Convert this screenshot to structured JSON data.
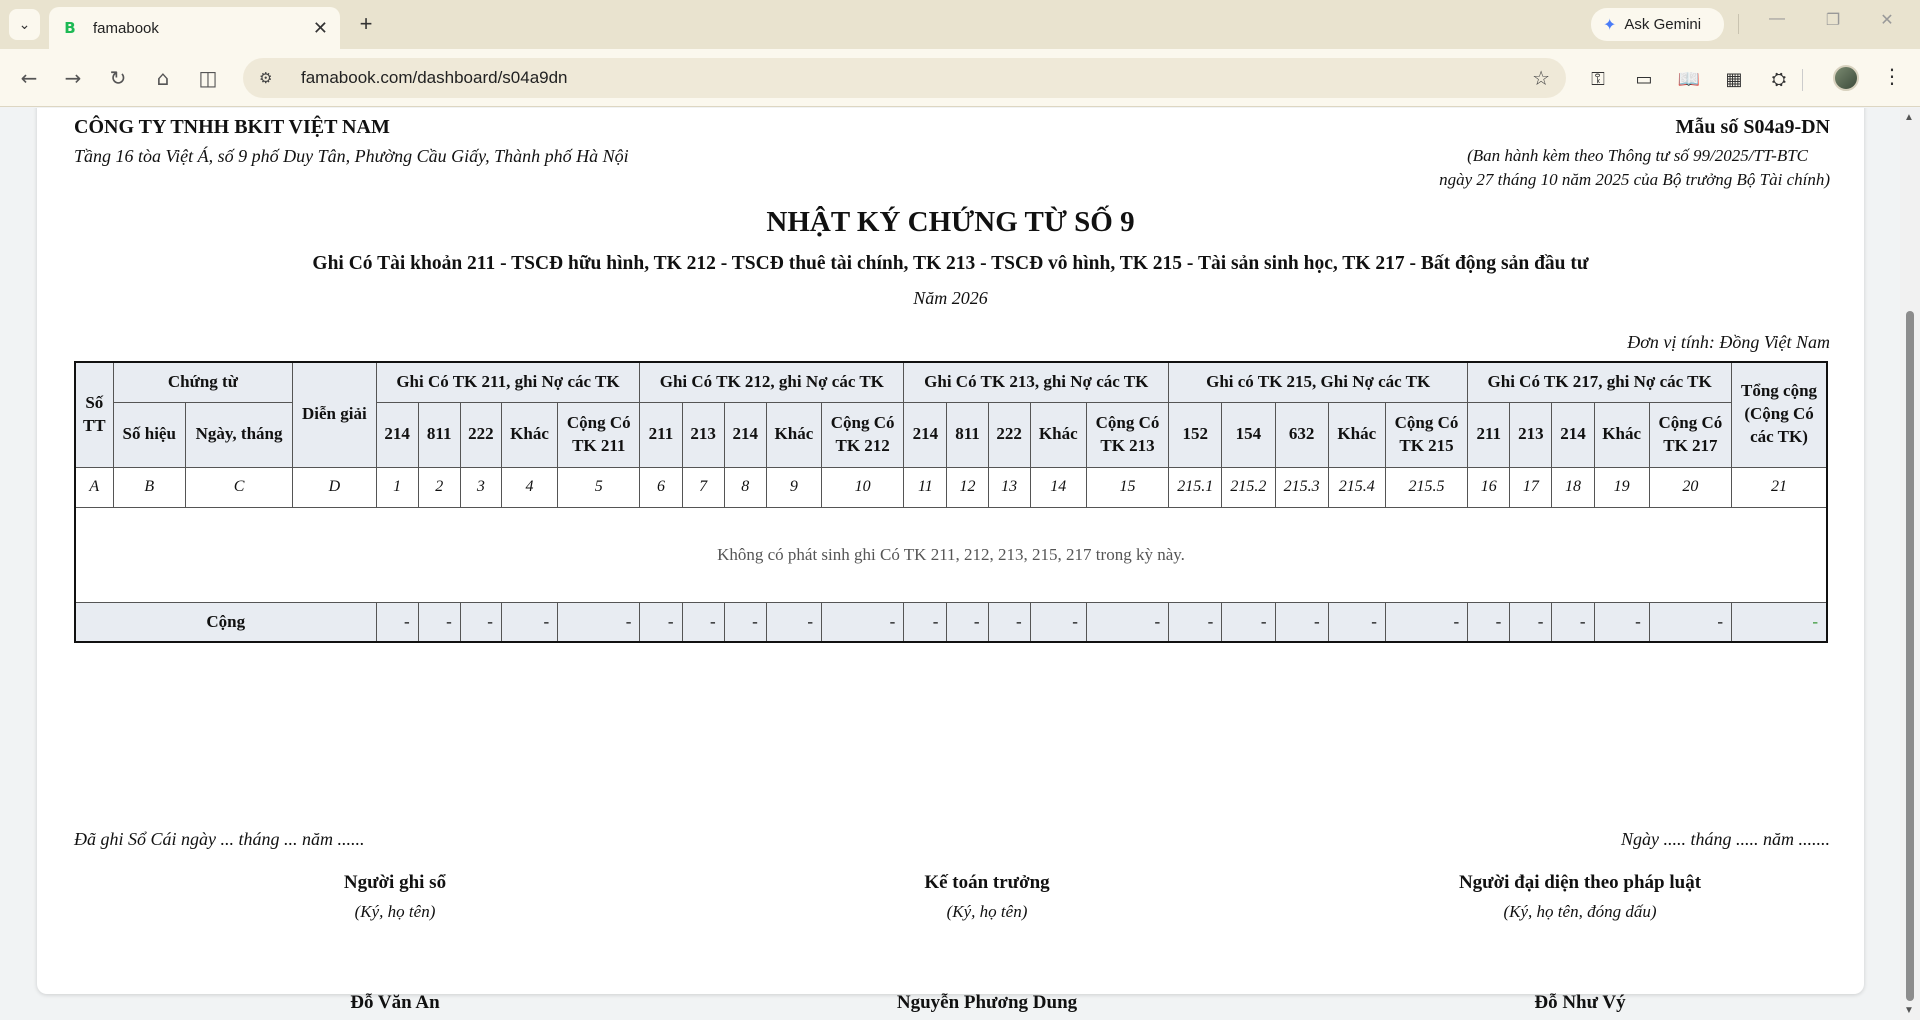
{
  "browser": {
    "tab_title": "famabook",
    "url": "famabook.com/dashboard/s04a9dn",
    "gemini_label": "Ask Gemini"
  },
  "doc": {
    "company": "CÔNG TY TNHH BKIT VIỆT NAM",
    "address": "Tầng 16 tòa Việt Á, số 9 phố Duy Tân, Phường Cầu Giấy, Thành phố Hà Nội",
    "form_no": "Mẫu số S04a9-DN",
    "decree_line1": "(Ban hành kèm theo Thông tư số 99/2025/TT-BTC",
    "decree_line2": "ngày 27 tháng 10 năm 2025 của Bộ trưởng Bộ Tài chính)",
    "title": "NHẬT KÝ CHỨNG TỪ SỐ 9",
    "subtitle": "Ghi Có Tài khoản 211 - TSCĐ hữu hình, TK 212 - TSCĐ thuê tài chính, TK 213 - TSCĐ vô hình, TK 215 - Tài sản sinh học, TK 217 - Bất động sản đầu tư",
    "year": "Năm 2026",
    "unit": "Đơn vị tính: Đồng Việt Nam"
  },
  "table": {
    "stt": "Số TT",
    "chung_tu": "Chứng từ",
    "so_hieu": "Số hiệu",
    "ngay_thang": "Ngày, tháng",
    "dien_giai": "Diễn giải",
    "group211": "Ghi Có TK 211, ghi Nợ các TK",
    "group212": "Ghi Có TK 212, ghi Nợ các TK",
    "group213": "Ghi Có TK 213, ghi Nợ các TK",
    "group215": "Ghi có TK 215, Ghi Nợ các TK",
    "group217": "Ghi Có TK 217, ghi Nợ các TK",
    "total_col": "Tổng cộng (Cộng Có các TK)",
    "sub211": [
      "214",
      "811",
      "222",
      "Khác",
      "Cộng Có TK 211"
    ],
    "sub212": [
      "211",
      "213",
      "214",
      "Khác",
      "Cộng Có TK 212"
    ],
    "sub213": [
      "214",
      "811",
      "222",
      "Khác",
      "Cộng Có TK 213"
    ],
    "sub215": [
      "152",
      "154",
      "632",
      "Khác",
      "Cộng Có TK 215"
    ],
    "sub217": [
      "211",
      "213",
      "214",
      "Khác",
      "Cộng Có TK 217"
    ],
    "index_row": [
      "A",
      "B",
      "C",
      "D",
      "1",
      "2",
      "3",
      "4",
      "5",
      "6",
      "7",
      "8",
      "9",
      "10",
      "11",
      "12",
      "13",
      "14",
      "15",
      "215.1",
      "215.2",
      "215.3",
      "215.4",
      "215.5",
      "16",
      "17",
      "18",
      "19",
      "20",
      "21"
    ],
    "empty_message": "Không có phát sinh ghi Có TK 211, 212, 213, 215, 217 trong kỳ này.",
    "total_label": "Cộng",
    "total_values": [
      "-",
      "-",
      "-",
      "-",
      "-",
      "-",
      "-",
      "-",
      "-",
      "-",
      "-",
      "-",
      "-",
      "-",
      "-",
      "-",
      "-",
      "-",
      "-",
      "-",
      "-",
      "-",
      "-",
      "-",
      "-",
      "-"
    ]
  },
  "footer": {
    "recorded": "Đã ghi Sổ Cái ngày ... tháng ... năm ......",
    "dateline": "Ngày ..... tháng ..... năm .......",
    "signers": [
      {
        "role": "Người ghi sổ",
        "note": "(Ký, họ tên)",
        "name": "Đỗ Văn An"
      },
      {
        "role": "Kế toán trưởng",
        "note": "(Ký, họ tên)",
        "name": "Nguyễn Phương Dung"
      },
      {
        "role": "Người đại diện theo pháp luật",
        "note": "(Ký, họ tên, đóng dấu)",
        "name": "Đỗ Như Vý"
      }
    ]
  }
}
